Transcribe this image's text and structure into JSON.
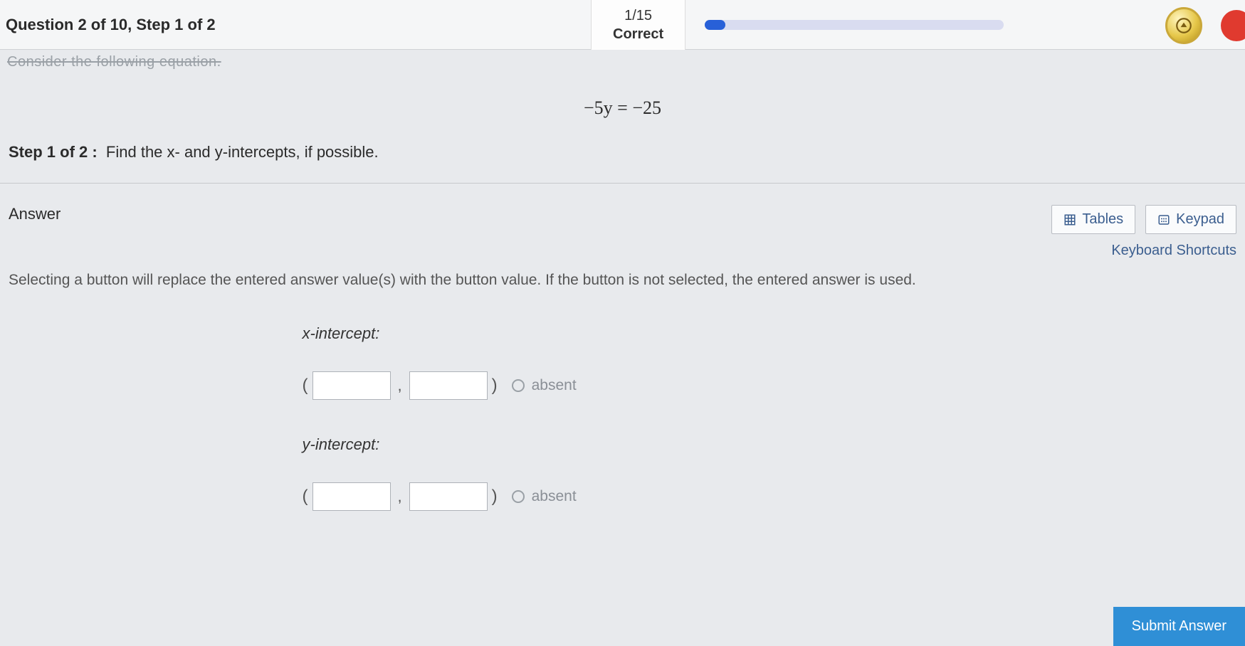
{
  "header": {
    "question_step": "Question 2 of 10, Step 1 of 2",
    "progress_count": "1/15",
    "progress_label": "Correct"
  },
  "faded_prompt": "Consider the following equation.",
  "equation": "−5y = −25",
  "step": {
    "prefix": "Step 1 of 2 :",
    "text": "Find the x- and y-intercepts, if possible."
  },
  "answer": {
    "heading": "Answer",
    "tables_btn": "Tables",
    "keypad_btn": "Keypad",
    "shortcuts": "Keyboard Shortcuts",
    "hint": "Selecting a button will replace the entered answer value(s) with the button value. If the button is not selected, the entered answer is used.",
    "x_label": "x-intercept:",
    "y_label": "y-intercept:",
    "absent": "absent",
    "submit": "Submit Answer"
  }
}
